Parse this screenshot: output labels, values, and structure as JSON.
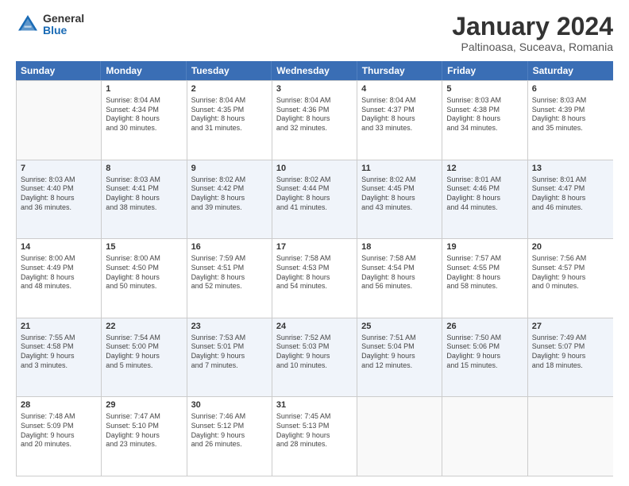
{
  "header": {
    "logo_general": "General",
    "logo_blue": "Blue",
    "month_title": "January 2024",
    "subtitle": "Paltinoasa, Suceava, Romania"
  },
  "calendar": {
    "weekdays": [
      "Sunday",
      "Monday",
      "Tuesday",
      "Wednesday",
      "Thursday",
      "Friday",
      "Saturday"
    ],
    "rows": [
      [
        {
          "day": "",
          "empty": true,
          "lines": []
        },
        {
          "day": "1",
          "lines": [
            "Sunrise: 8:04 AM",
            "Sunset: 4:34 PM",
            "Daylight: 8 hours",
            "and 30 minutes."
          ]
        },
        {
          "day": "2",
          "lines": [
            "Sunrise: 8:04 AM",
            "Sunset: 4:35 PM",
            "Daylight: 8 hours",
            "and 31 minutes."
          ]
        },
        {
          "day": "3",
          "lines": [
            "Sunrise: 8:04 AM",
            "Sunset: 4:36 PM",
            "Daylight: 8 hours",
            "and 32 minutes."
          ]
        },
        {
          "day": "4",
          "lines": [
            "Sunrise: 8:04 AM",
            "Sunset: 4:37 PM",
            "Daylight: 8 hours",
            "and 33 minutes."
          ]
        },
        {
          "day": "5",
          "lines": [
            "Sunrise: 8:03 AM",
            "Sunset: 4:38 PM",
            "Daylight: 8 hours",
            "and 34 minutes."
          ]
        },
        {
          "day": "6",
          "lines": [
            "Sunrise: 8:03 AM",
            "Sunset: 4:39 PM",
            "Daylight: 8 hours",
            "and 35 minutes."
          ]
        }
      ],
      [
        {
          "day": "7",
          "lines": [
            "Sunrise: 8:03 AM",
            "Sunset: 4:40 PM",
            "Daylight: 8 hours",
            "and 36 minutes."
          ]
        },
        {
          "day": "8",
          "lines": [
            "Sunrise: 8:03 AM",
            "Sunset: 4:41 PM",
            "Daylight: 8 hours",
            "and 38 minutes."
          ]
        },
        {
          "day": "9",
          "lines": [
            "Sunrise: 8:02 AM",
            "Sunset: 4:42 PM",
            "Daylight: 8 hours",
            "and 39 minutes."
          ]
        },
        {
          "day": "10",
          "lines": [
            "Sunrise: 8:02 AM",
            "Sunset: 4:44 PM",
            "Daylight: 8 hours",
            "and 41 minutes."
          ]
        },
        {
          "day": "11",
          "lines": [
            "Sunrise: 8:02 AM",
            "Sunset: 4:45 PM",
            "Daylight: 8 hours",
            "and 43 minutes."
          ]
        },
        {
          "day": "12",
          "lines": [
            "Sunrise: 8:01 AM",
            "Sunset: 4:46 PM",
            "Daylight: 8 hours",
            "and 44 minutes."
          ]
        },
        {
          "day": "13",
          "lines": [
            "Sunrise: 8:01 AM",
            "Sunset: 4:47 PM",
            "Daylight: 8 hours",
            "and 46 minutes."
          ]
        }
      ],
      [
        {
          "day": "14",
          "lines": [
            "Sunrise: 8:00 AM",
            "Sunset: 4:49 PM",
            "Daylight: 8 hours",
            "and 48 minutes."
          ]
        },
        {
          "day": "15",
          "lines": [
            "Sunrise: 8:00 AM",
            "Sunset: 4:50 PM",
            "Daylight: 8 hours",
            "and 50 minutes."
          ]
        },
        {
          "day": "16",
          "lines": [
            "Sunrise: 7:59 AM",
            "Sunset: 4:51 PM",
            "Daylight: 8 hours",
            "and 52 minutes."
          ]
        },
        {
          "day": "17",
          "lines": [
            "Sunrise: 7:58 AM",
            "Sunset: 4:53 PM",
            "Daylight: 8 hours",
            "and 54 minutes."
          ]
        },
        {
          "day": "18",
          "lines": [
            "Sunrise: 7:58 AM",
            "Sunset: 4:54 PM",
            "Daylight: 8 hours",
            "and 56 minutes."
          ]
        },
        {
          "day": "19",
          "lines": [
            "Sunrise: 7:57 AM",
            "Sunset: 4:55 PM",
            "Daylight: 8 hours",
            "and 58 minutes."
          ]
        },
        {
          "day": "20",
          "lines": [
            "Sunrise: 7:56 AM",
            "Sunset: 4:57 PM",
            "Daylight: 9 hours",
            "and 0 minutes."
          ]
        }
      ],
      [
        {
          "day": "21",
          "lines": [
            "Sunrise: 7:55 AM",
            "Sunset: 4:58 PM",
            "Daylight: 9 hours",
            "and 3 minutes."
          ]
        },
        {
          "day": "22",
          "lines": [
            "Sunrise: 7:54 AM",
            "Sunset: 5:00 PM",
            "Daylight: 9 hours",
            "and 5 minutes."
          ]
        },
        {
          "day": "23",
          "lines": [
            "Sunrise: 7:53 AM",
            "Sunset: 5:01 PM",
            "Daylight: 9 hours",
            "and 7 minutes."
          ]
        },
        {
          "day": "24",
          "lines": [
            "Sunrise: 7:52 AM",
            "Sunset: 5:03 PM",
            "Daylight: 9 hours",
            "and 10 minutes."
          ]
        },
        {
          "day": "25",
          "lines": [
            "Sunrise: 7:51 AM",
            "Sunset: 5:04 PM",
            "Daylight: 9 hours",
            "and 12 minutes."
          ]
        },
        {
          "day": "26",
          "lines": [
            "Sunrise: 7:50 AM",
            "Sunset: 5:06 PM",
            "Daylight: 9 hours",
            "and 15 minutes."
          ]
        },
        {
          "day": "27",
          "lines": [
            "Sunrise: 7:49 AM",
            "Sunset: 5:07 PM",
            "Daylight: 9 hours",
            "and 18 minutes."
          ]
        }
      ],
      [
        {
          "day": "28",
          "lines": [
            "Sunrise: 7:48 AM",
            "Sunset: 5:09 PM",
            "Daylight: 9 hours",
            "and 20 minutes."
          ]
        },
        {
          "day": "29",
          "lines": [
            "Sunrise: 7:47 AM",
            "Sunset: 5:10 PM",
            "Daylight: 9 hours",
            "and 23 minutes."
          ]
        },
        {
          "day": "30",
          "lines": [
            "Sunrise: 7:46 AM",
            "Sunset: 5:12 PM",
            "Daylight: 9 hours",
            "and 26 minutes."
          ]
        },
        {
          "day": "31",
          "lines": [
            "Sunrise: 7:45 AM",
            "Sunset: 5:13 PM",
            "Daylight: 9 hours",
            "and 28 minutes."
          ]
        },
        {
          "day": "",
          "empty": true,
          "lines": []
        },
        {
          "day": "",
          "empty": true,
          "lines": []
        },
        {
          "day": "",
          "empty": true,
          "lines": []
        }
      ]
    ]
  }
}
